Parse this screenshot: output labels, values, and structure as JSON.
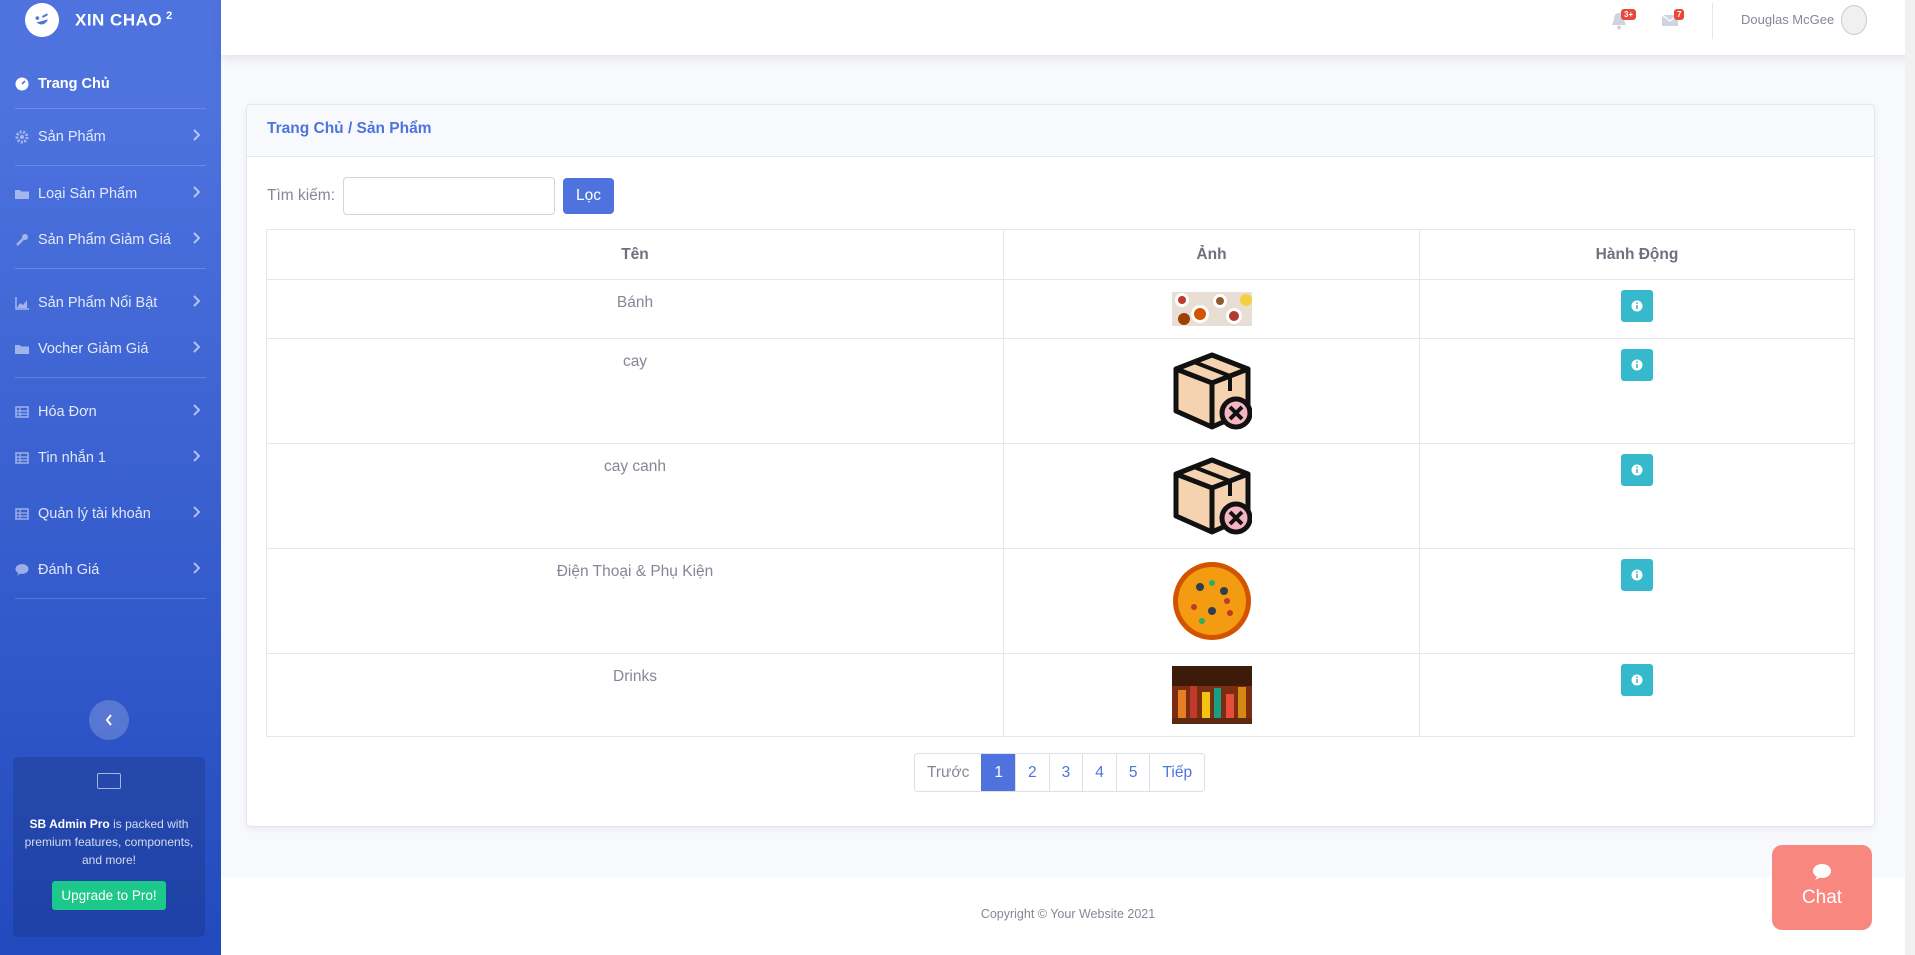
{
  "brand": {
    "name": "XIN CHAO",
    "sup": "2"
  },
  "sidebar": {
    "items": [
      {
        "label": "Trang Chủ"
      },
      {
        "label": "Sản Phẩm"
      },
      {
        "label": "Loại Sản Phẩm"
      },
      {
        "label": "Sản Phẩm Giảm Giá"
      },
      {
        "label": "Sản Phẩm Nổi Bật"
      },
      {
        "label": "Vocher Giảm Giá"
      },
      {
        "label": "Hóa Đơn"
      },
      {
        "label": "Tin nhắn 1"
      },
      {
        "label": "Quản lý tài khoản"
      },
      {
        "label": "Đánh Giá"
      }
    ],
    "promo": {
      "img_alt": "...",
      "strong": "SB Admin Pro",
      "text": "is packed with premium features, components, and more!",
      "button": "Upgrade to Pro!"
    }
  },
  "topbar": {
    "alerts_badge": "3+",
    "messages_badge": "7",
    "user_name": "Douglas McGee"
  },
  "breadcrumb": "Trang Chủ / Sản Phẩm",
  "search": {
    "label": "Tìm kiếm:",
    "value": "",
    "button": "Lọc"
  },
  "table": {
    "headers": [
      "Tên",
      "Ảnh",
      "Hành Động"
    ],
    "rows": [
      {
        "name": "Bánh",
        "image": "food-table-photo"
      },
      {
        "name": "cay",
        "image": "missing-box-icon"
      },
      {
        "name": "cay canh",
        "image": "missing-box-icon"
      },
      {
        "name": "Điện Thoại & Phụ Kiện",
        "image": "pizza-photo"
      },
      {
        "name": "Drinks",
        "image": "drinks-photo"
      }
    ]
  },
  "pagination": {
    "prev": "Trước",
    "pages": [
      "1",
      "2",
      "3",
      "4",
      "5"
    ],
    "current": "1",
    "next": "Tiếp"
  },
  "footer": {
    "copyright": "Copyright © Your Website 2021"
  },
  "chat": {
    "label": "Chat"
  },
  "colors": {
    "primary": "#4e73df",
    "info": "#36b9cc",
    "success": "#1cc88a",
    "danger": "#e74a3b",
    "chat": "#f8877f"
  }
}
